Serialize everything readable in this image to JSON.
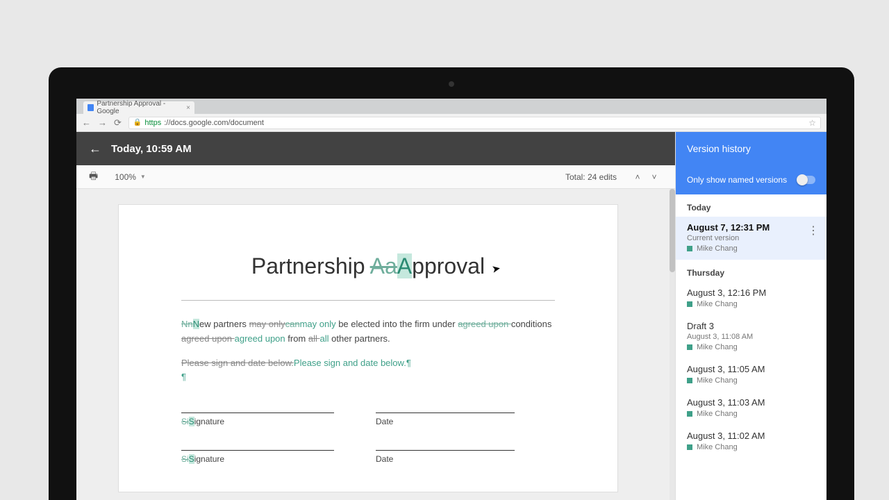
{
  "browser": {
    "tab_title": "Partnership Approval - Google",
    "url_secure": "https",
    "url_rest": "://docs.google.com/document"
  },
  "header": {
    "title": "Today, 10:59 AM"
  },
  "toolbar": {
    "zoom": "100%",
    "edit_count": "Total: 24 edits"
  },
  "document": {
    "title_pre": "Partnership ",
    "title_strike": "Aa",
    "title_hl": "A",
    "title_post": "pproval",
    "p1_seg1_strike": "Nn",
    "p1_seg1_ins": "N",
    "p1_seg2": "ew partners ",
    "p1_seg3_strike": "may only",
    "p1_seg3b_strike": "can",
    "p1_seg3_ins": "may only",
    "p1_seg4": " be elected into the firm under ",
    "p1_seg5_strike": "agreed upon ",
    "p1_seg6": "conditions ",
    "p1_seg7_strike": "agreed upon ",
    "p1_seg7_ins": "agreed upon",
    "p1_seg8": " from ",
    "p1_seg9_strike": "all ",
    "p1_seg9_ins": "all",
    "p1_seg10": " other partners.",
    "p2_strike": "Please sign and date below.",
    "p2_ins": "Please sign and date below.",
    "sig_label_pre": "Si",
    "sig_label_hl": "S",
    "sig_label_post": "ignature",
    "date_label": "Date"
  },
  "sidebar": {
    "title": "Version history",
    "filter_label": "Only show named versions",
    "groups": [
      {
        "label": "Today"
      },
      {
        "label": "Thursday"
      }
    ],
    "versions": {
      "current": {
        "time": "August 7, 12:31 PM",
        "sub": "Current version",
        "editor": "Mike Chang"
      },
      "v1": {
        "time": "August 3, 12:16 PM",
        "editor": "Mike Chang"
      },
      "v2": {
        "time": "Draft 3",
        "sub": "August 3, 11:08 AM",
        "editor": "Mike Chang"
      },
      "v3": {
        "time": "August 3, 11:05 AM",
        "editor": "Mike Chang"
      },
      "v4": {
        "time": "August 3, 11:03 AM",
        "editor": "Mike Chang"
      },
      "v5": {
        "time": "August 3, 11:02 AM",
        "editor": "Mike Chang"
      }
    }
  }
}
